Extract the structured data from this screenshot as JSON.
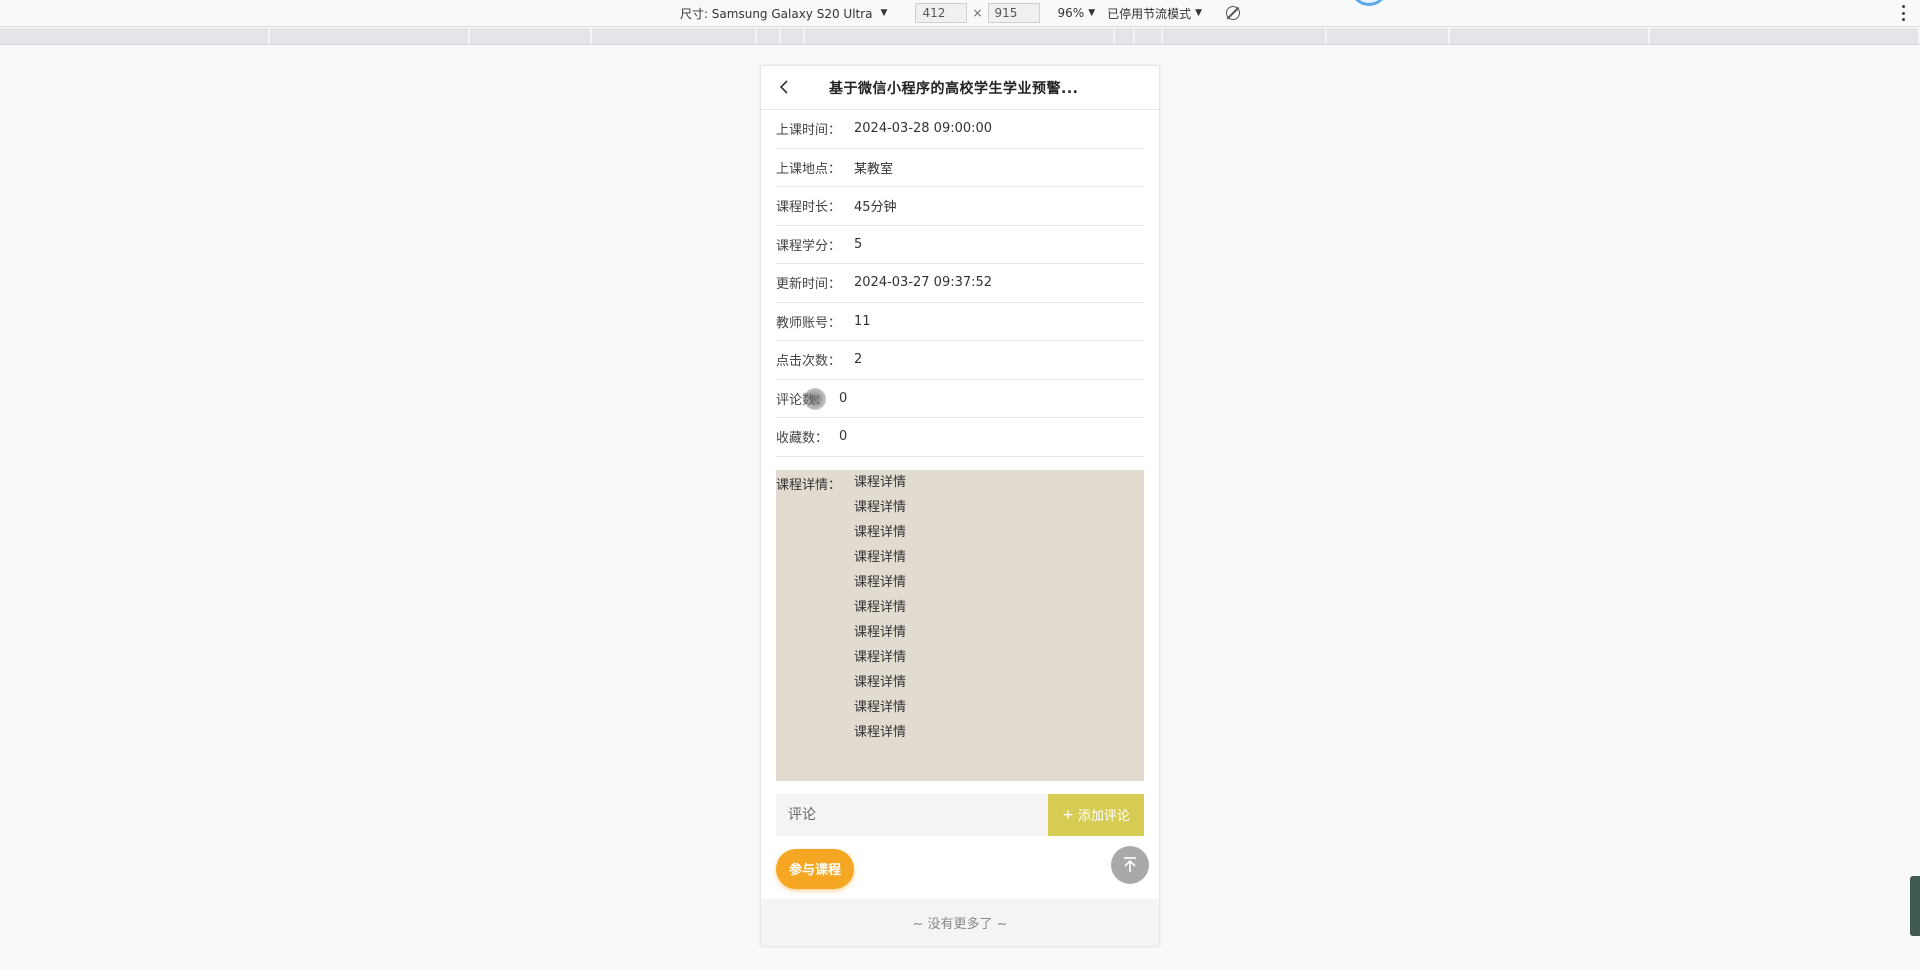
{
  "devtools": {
    "size_label": "尺寸: Samsung Galaxy S20 Ultra",
    "width": "412",
    "height": "915",
    "times": "×",
    "zoom": "96%",
    "throttle": "已停用节流模式"
  },
  "nav": {
    "title": "基于微信小程序的高校学生学业预警..."
  },
  "fields": [
    {
      "label": "上课时间：",
      "value": "2024-03-28 09:00:00"
    },
    {
      "label": "上课地点：",
      "value": "某教室"
    },
    {
      "label": "课程时长：",
      "value": "45分钟"
    },
    {
      "label": "课程学分：",
      "value": "5"
    },
    {
      "label": "更新时间：",
      "value": "2024-03-27 09:37:52"
    },
    {
      "label": "教师账号：",
      "value": "11"
    },
    {
      "label": "点击次数：",
      "value": "2"
    },
    {
      "label": "评论数：",
      "value": "0"
    },
    {
      "label": "收藏数：",
      "value": "0"
    }
  ],
  "detail": {
    "label": "课程详情：",
    "lines": [
      "课程详情",
      "课程详情",
      "课程详情",
      "课程详情",
      "课程详情",
      "课程详情",
      "课程详情",
      "课程详情",
      "课程详情",
      "课程详情",
      "课程详情"
    ]
  },
  "comment": {
    "placeholder": "评论",
    "add_label": "添加评论",
    "add_icon": "+"
  },
  "join_label": "参与课程",
  "footer_text": "~ 没有更多了 ~",
  "colors": {
    "detail_bg": "#e2dbd0",
    "add_comment_bg": "#d6cc54",
    "join_bg": "#f5a623",
    "top_btn_bg": "#a9a9a9"
  }
}
